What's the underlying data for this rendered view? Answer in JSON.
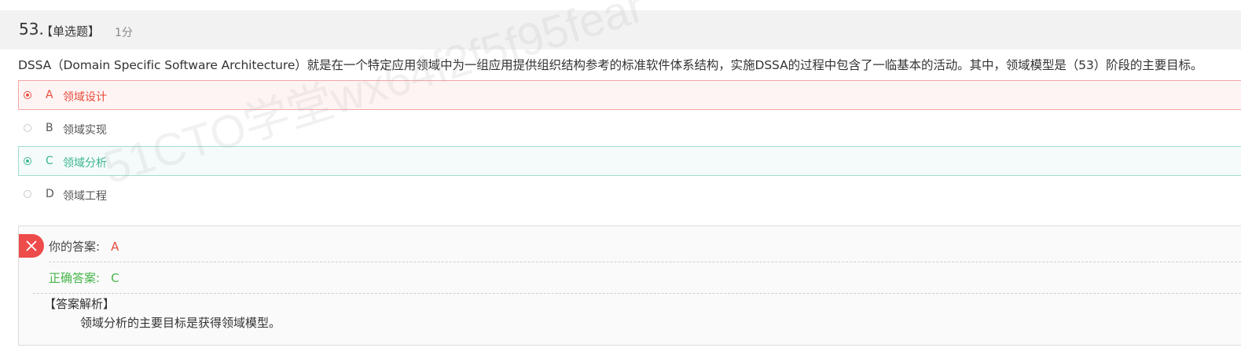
{
  "question": {
    "number": "53.",
    "type": "【单选题】",
    "score": "1分",
    "stem": "DSSA（Domain Specific Software Architecture）就是在一个特定应用领域中为一组应用提供组织结构参考的标准软件体系结构，实施DSSA的过程中包含了一临基本的活动。其中，领域模型是（53）阶段的主要目标。"
  },
  "options": [
    {
      "letter": "A",
      "text": "领域设计",
      "state": "wrong-selected"
    },
    {
      "letter": "B",
      "text": "领域实现",
      "state": "normal"
    },
    {
      "letter": "C",
      "text": "领域分析",
      "state": "correct"
    },
    {
      "letter": "D",
      "text": "领域工程",
      "state": "normal"
    }
  ],
  "answer": {
    "your_label": "你的答案:",
    "your_value": "A",
    "correct_label": "正确答案:",
    "correct_value": "C",
    "explanation_title": "【答案解析】",
    "explanation_text": "领域分析的主要目标是获得领域模型。",
    "status_icon": "close-icon"
  },
  "watermark": "51CTO学堂wx64f2f5f95fear",
  "colors": {
    "wrong": "#e74c3c",
    "correct": "#3cb68e",
    "correct_answer_text": "#46b54a",
    "header_bg": "#f2f2f2"
  }
}
